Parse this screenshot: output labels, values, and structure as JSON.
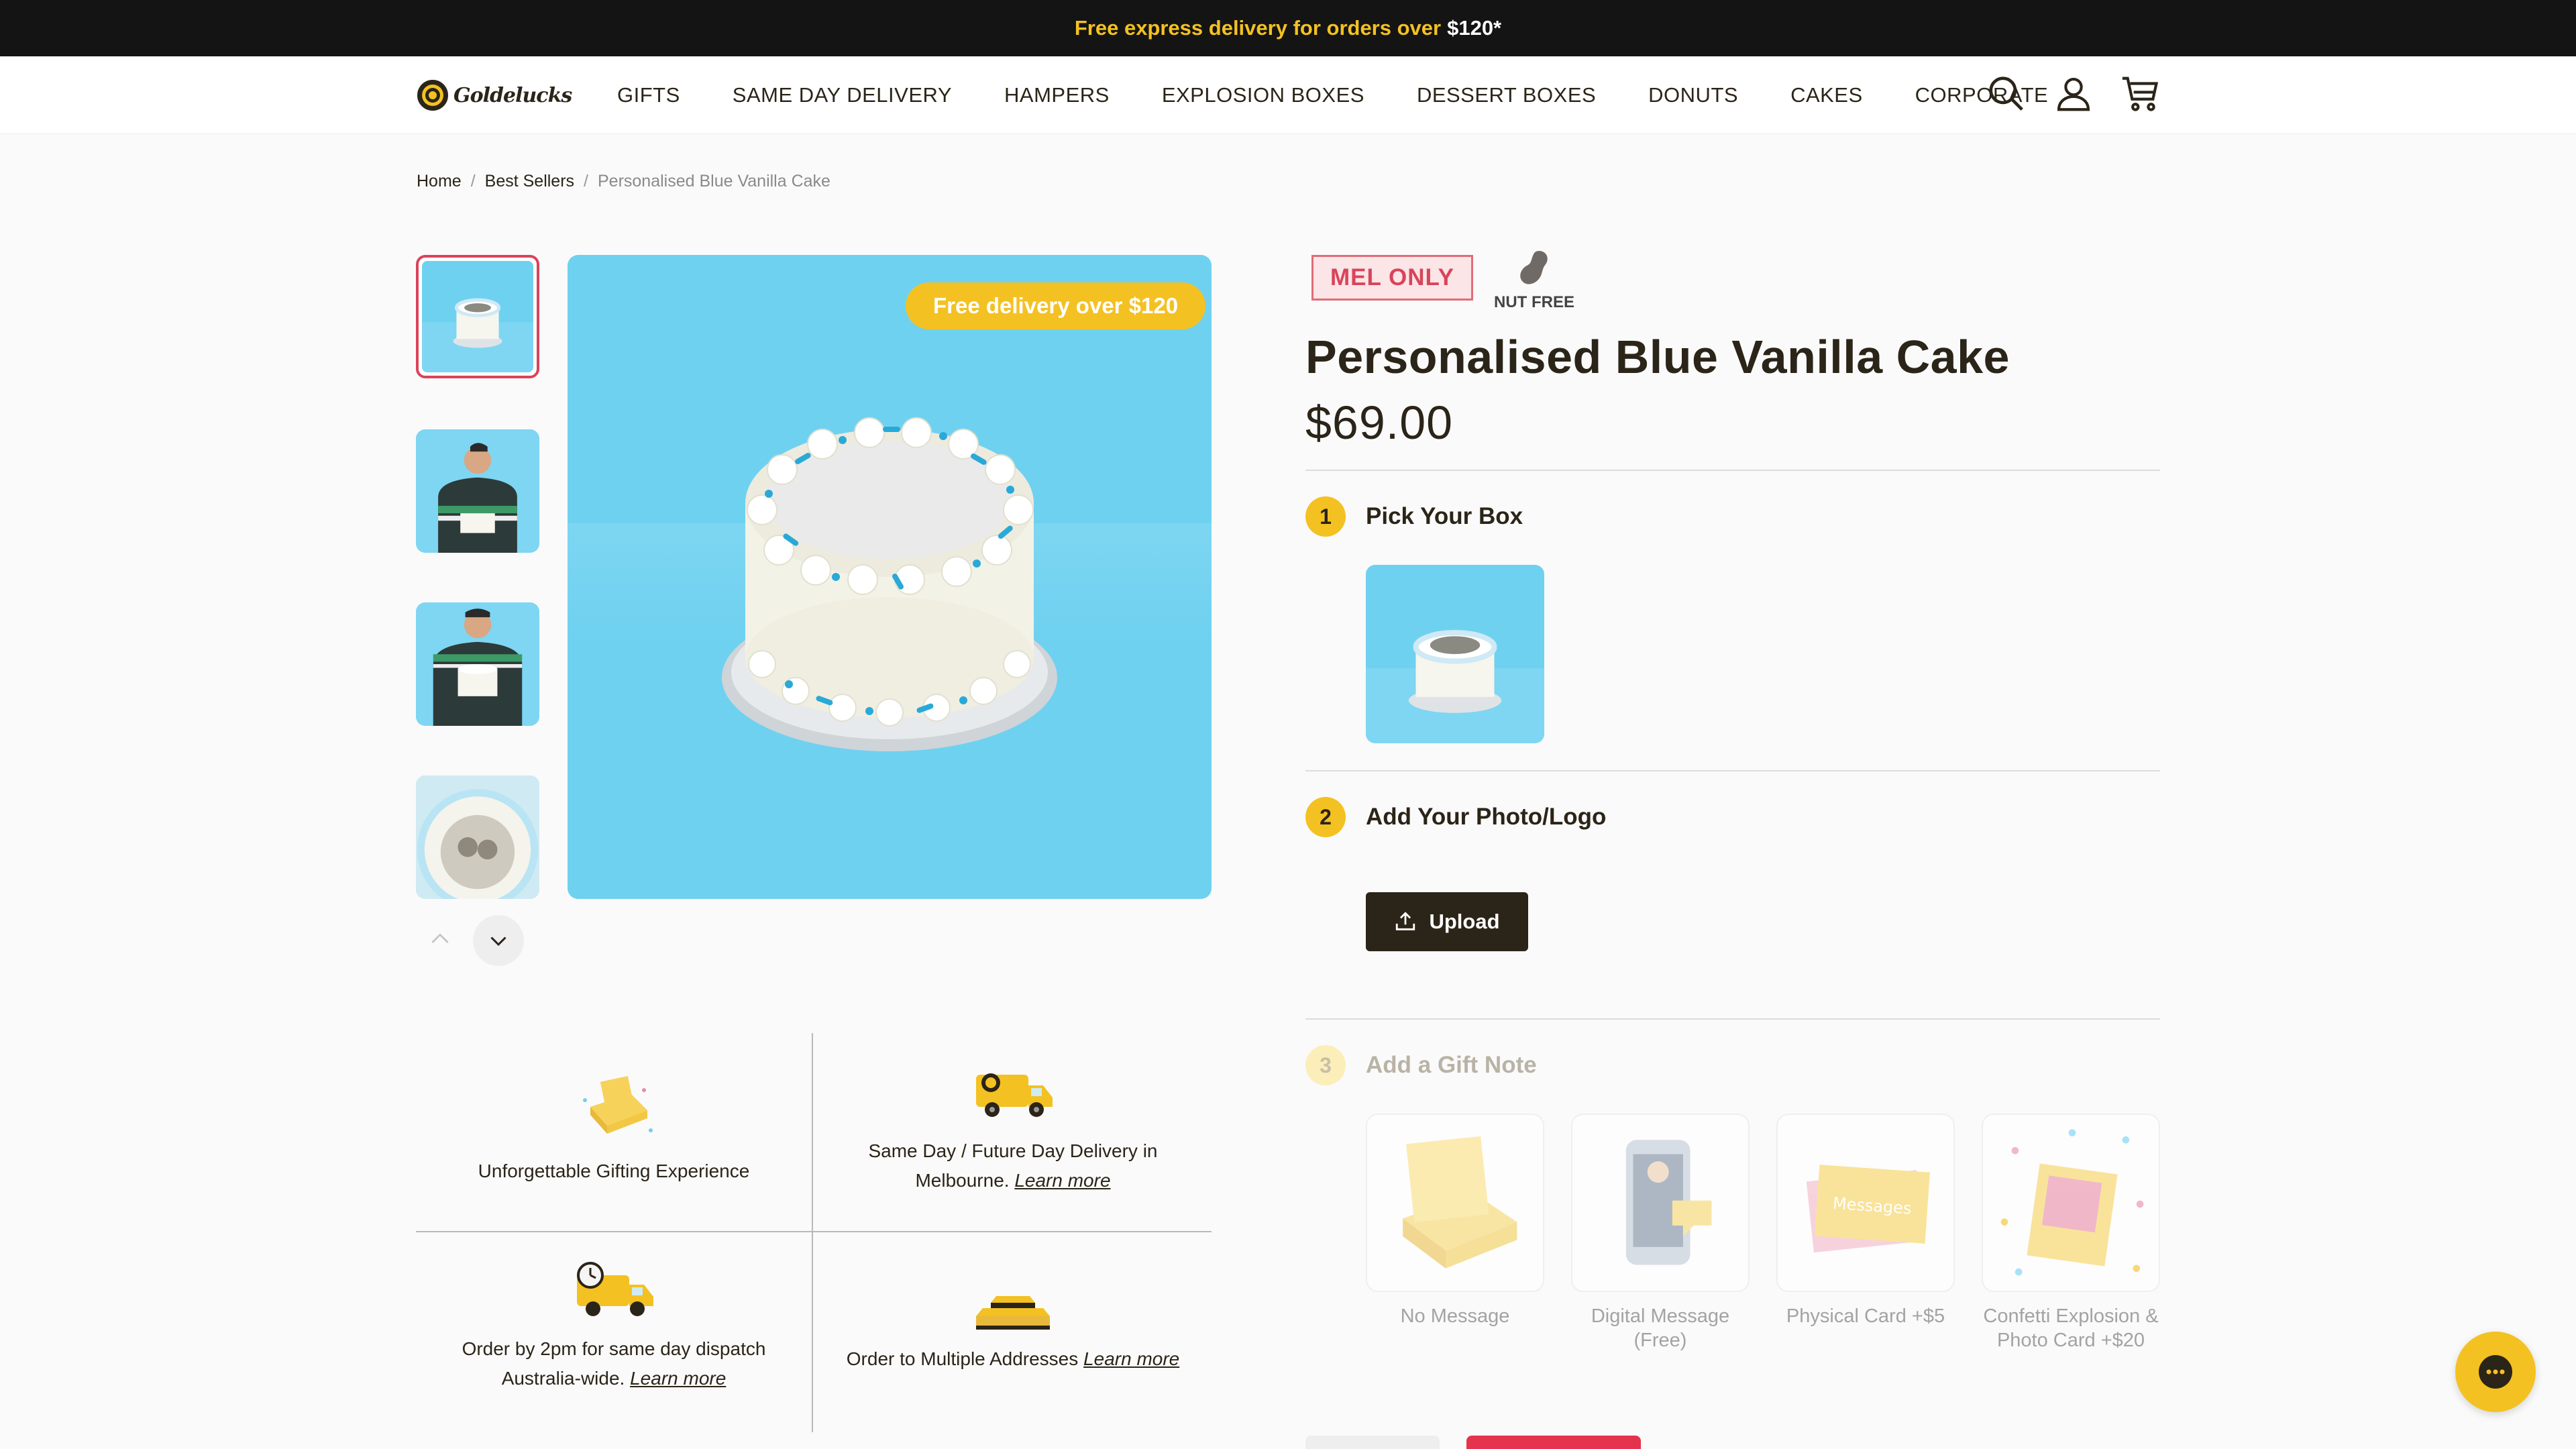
{
  "announcement": {
    "text": "Free express delivery for orders over",
    "amount": "$120*"
  },
  "header": {
    "logo": "Goldelucks",
    "nav": [
      "GIFTS",
      "SAME DAY DELIVERY",
      "HAMPERS",
      "EXPLOSION BOXES",
      "DESSERT BOXES",
      "DONUTS",
      "CAKES",
      "CORPORATE"
    ],
    "icons": [
      "search-icon",
      "account-icon",
      "cart-icon"
    ]
  },
  "breadcrumb": {
    "home": "Home",
    "section": "Best Sellers",
    "current": "Personalised Blue Vanilla Cake",
    "separator": "/"
  },
  "gallery": {
    "promo_pill": "Free delivery over $120",
    "thumbnail_count": 4
  },
  "features": [
    {
      "text": "Unforgettable Gifting Experience",
      "link": ""
    },
    {
      "text": "Same Day / Future Day Delivery in Melbourne.",
      "link": "Learn more"
    },
    {
      "text": "Order by 2pm for same day dispatch Australia-wide.",
      "link": "Learn more"
    },
    {
      "text": "Order to Multiple Addresses",
      "link": "Learn more"
    }
  ],
  "product": {
    "badge": "MEL ONLY",
    "nut_label": "NUT FREE",
    "title": "Personalised Blue Vanilla Cake",
    "price": "$69.00"
  },
  "steps": [
    {
      "number": "1",
      "label": "Pick Your Box"
    },
    {
      "number": "2",
      "label": "Add Your Photo/Logo"
    },
    {
      "number": "3",
      "label": "Add a Gift Note"
    }
  ],
  "upload_label": "Upload",
  "gift_notes": [
    {
      "label": "No Message"
    },
    {
      "label": "Digital Message (Free)"
    },
    {
      "label": "Physical Card +$5"
    },
    {
      "label": "Confetti Explosion & Photo Card +$20"
    }
  ],
  "gift_note_card_text": "Messages",
  "colors": {
    "brand_yellow": "#f4c122",
    "dark": "#2b2418",
    "accent_red": "#d9445a",
    "sky_blue": "#6fd1f0"
  }
}
